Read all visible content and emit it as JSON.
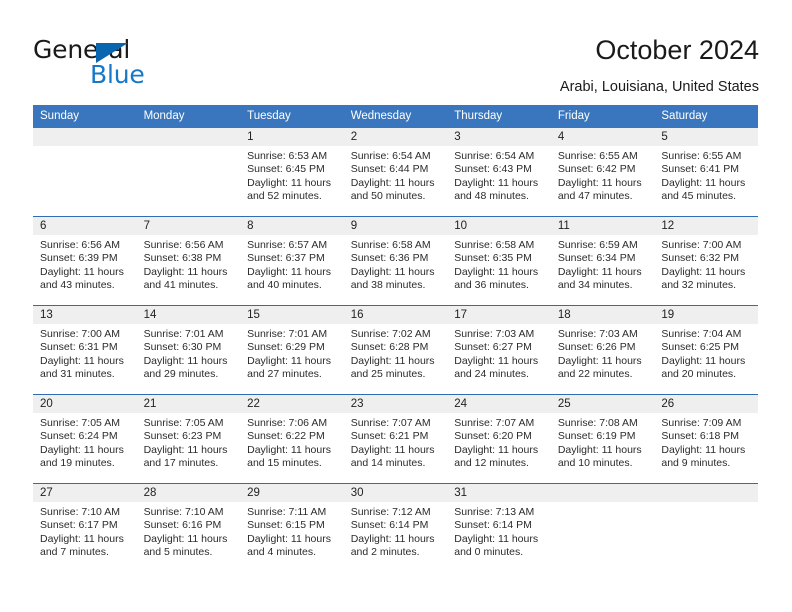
{
  "brand": {
    "name_top": "General",
    "name_bottom": "Blue",
    "triangle_color": "#0a65b0",
    "blue_text_color": "#1878c8"
  },
  "header": {
    "title": "October 2024",
    "subtitle": "Arabi, Louisiana, United States"
  },
  "theme": {
    "header_blue": "#3a76bd",
    "row_divider_blue": "#2f6cb3",
    "daynum_band_gray": "#efefef"
  },
  "calendar": {
    "weekday_headers": [
      "Sunday",
      "Monday",
      "Tuesday",
      "Wednesday",
      "Thursday",
      "Friday",
      "Saturday"
    ],
    "weeks": [
      [
        {
          "day": "",
          "sunrise": "",
          "sunset": "",
          "daylight_line1": "",
          "daylight_line2": ""
        },
        {
          "day": "",
          "sunrise": "",
          "sunset": "",
          "daylight_line1": "",
          "daylight_line2": ""
        },
        {
          "day": "1",
          "sunrise": "Sunrise: 6:53 AM",
          "sunset": "Sunset: 6:45 PM",
          "daylight_line1": "Daylight: 11 hours",
          "daylight_line2": "and 52 minutes."
        },
        {
          "day": "2",
          "sunrise": "Sunrise: 6:54 AM",
          "sunset": "Sunset: 6:44 PM",
          "daylight_line1": "Daylight: 11 hours",
          "daylight_line2": "and 50 minutes."
        },
        {
          "day": "3",
          "sunrise": "Sunrise: 6:54 AM",
          "sunset": "Sunset: 6:43 PM",
          "daylight_line1": "Daylight: 11 hours",
          "daylight_line2": "and 48 minutes."
        },
        {
          "day": "4",
          "sunrise": "Sunrise: 6:55 AM",
          "sunset": "Sunset: 6:42 PM",
          "daylight_line1": "Daylight: 11 hours",
          "daylight_line2": "and 47 minutes."
        },
        {
          "day": "5",
          "sunrise": "Sunrise: 6:55 AM",
          "sunset": "Sunset: 6:41 PM",
          "daylight_line1": "Daylight: 11 hours",
          "daylight_line2": "and 45 minutes."
        }
      ],
      [
        {
          "day": "6",
          "sunrise": "Sunrise: 6:56 AM",
          "sunset": "Sunset: 6:39 PM",
          "daylight_line1": "Daylight: 11 hours",
          "daylight_line2": "and 43 minutes."
        },
        {
          "day": "7",
          "sunrise": "Sunrise: 6:56 AM",
          "sunset": "Sunset: 6:38 PM",
          "daylight_line1": "Daylight: 11 hours",
          "daylight_line2": "and 41 minutes."
        },
        {
          "day": "8",
          "sunrise": "Sunrise: 6:57 AM",
          "sunset": "Sunset: 6:37 PM",
          "daylight_line1": "Daylight: 11 hours",
          "daylight_line2": "and 40 minutes."
        },
        {
          "day": "9",
          "sunrise": "Sunrise: 6:58 AM",
          "sunset": "Sunset: 6:36 PM",
          "daylight_line1": "Daylight: 11 hours",
          "daylight_line2": "and 38 minutes."
        },
        {
          "day": "10",
          "sunrise": "Sunrise: 6:58 AM",
          "sunset": "Sunset: 6:35 PM",
          "daylight_line1": "Daylight: 11 hours",
          "daylight_line2": "and 36 minutes."
        },
        {
          "day": "11",
          "sunrise": "Sunrise: 6:59 AM",
          "sunset": "Sunset: 6:34 PM",
          "daylight_line1": "Daylight: 11 hours",
          "daylight_line2": "and 34 minutes."
        },
        {
          "day": "12",
          "sunrise": "Sunrise: 7:00 AM",
          "sunset": "Sunset: 6:32 PM",
          "daylight_line1": "Daylight: 11 hours",
          "daylight_line2": "and 32 minutes."
        }
      ],
      [
        {
          "day": "13",
          "sunrise": "Sunrise: 7:00 AM",
          "sunset": "Sunset: 6:31 PM",
          "daylight_line1": "Daylight: 11 hours",
          "daylight_line2": "and 31 minutes."
        },
        {
          "day": "14",
          "sunrise": "Sunrise: 7:01 AM",
          "sunset": "Sunset: 6:30 PM",
          "daylight_line1": "Daylight: 11 hours",
          "daylight_line2": "and 29 minutes."
        },
        {
          "day": "15",
          "sunrise": "Sunrise: 7:01 AM",
          "sunset": "Sunset: 6:29 PM",
          "daylight_line1": "Daylight: 11 hours",
          "daylight_line2": "and 27 minutes."
        },
        {
          "day": "16",
          "sunrise": "Sunrise: 7:02 AM",
          "sunset": "Sunset: 6:28 PM",
          "daylight_line1": "Daylight: 11 hours",
          "daylight_line2": "and 25 minutes."
        },
        {
          "day": "17",
          "sunrise": "Sunrise: 7:03 AM",
          "sunset": "Sunset: 6:27 PM",
          "daylight_line1": "Daylight: 11 hours",
          "daylight_line2": "and 24 minutes."
        },
        {
          "day": "18",
          "sunrise": "Sunrise: 7:03 AM",
          "sunset": "Sunset: 6:26 PM",
          "daylight_line1": "Daylight: 11 hours",
          "daylight_line2": "and 22 minutes."
        },
        {
          "day": "19",
          "sunrise": "Sunrise: 7:04 AM",
          "sunset": "Sunset: 6:25 PM",
          "daylight_line1": "Daylight: 11 hours",
          "daylight_line2": "and 20 minutes."
        }
      ],
      [
        {
          "day": "20",
          "sunrise": "Sunrise: 7:05 AM",
          "sunset": "Sunset: 6:24 PM",
          "daylight_line1": "Daylight: 11 hours",
          "daylight_line2": "and 19 minutes."
        },
        {
          "day": "21",
          "sunrise": "Sunrise: 7:05 AM",
          "sunset": "Sunset: 6:23 PM",
          "daylight_line1": "Daylight: 11 hours",
          "daylight_line2": "and 17 minutes."
        },
        {
          "day": "22",
          "sunrise": "Sunrise: 7:06 AM",
          "sunset": "Sunset: 6:22 PM",
          "daylight_line1": "Daylight: 11 hours",
          "daylight_line2": "and 15 minutes."
        },
        {
          "day": "23",
          "sunrise": "Sunrise: 7:07 AM",
          "sunset": "Sunset: 6:21 PM",
          "daylight_line1": "Daylight: 11 hours",
          "daylight_line2": "and 14 minutes."
        },
        {
          "day": "24",
          "sunrise": "Sunrise: 7:07 AM",
          "sunset": "Sunset: 6:20 PM",
          "daylight_line1": "Daylight: 11 hours",
          "daylight_line2": "and 12 minutes."
        },
        {
          "day": "25",
          "sunrise": "Sunrise: 7:08 AM",
          "sunset": "Sunset: 6:19 PM",
          "daylight_line1": "Daylight: 11 hours",
          "daylight_line2": "and 10 minutes."
        },
        {
          "day": "26",
          "sunrise": "Sunrise: 7:09 AM",
          "sunset": "Sunset: 6:18 PM",
          "daylight_line1": "Daylight: 11 hours",
          "daylight_line2": "and 9 minutes."
        }
      ],
      [
        {
          "day": "27",
          "sunrise": "Sunrise: 7:10 AM",
          "sunset": "Sunset: 6:17 PM",
          "daylight_line1": "Daylight: 11 hours",
          "daylight_line2": "and 7 minutes."
        },
        {
          "day": "28",
          "sunrise": "Sunrise: 7:10 AM",
          "sunset": "Sunset: 6:16 PM",
          "daylight_line1": "Daylight: 11 hours",
          "daylight_line2": "and 5 minutes."
        },
        {
          "day": "29",
          "sunrise": "Sunrise: 7:11 AM",
          "sunset": "Sunset: 6:15 PM",
          "daylight_line1": "Daylight: 11 hours",
          "daylight_line2": "and 4 minutes."
        },
        {
          "day": "30",
          "sunrise": "Sunrise: 7:12 AM",
          "sunset": "Sunset: 6:14 PM",
          "daylight_line1": "Daylight: 11 hours",
          "daylight_line2": "and 2 minutes."
        },
        {
          "day": "31",
          "sunrise": "Sunrise: 7:13 AM",
          "sunset": "Sunset: 6:14 PM",
          "daylight_line1": "Daylight: 11 hours",
          "daylight_line2": "and 0 minutes."
        },
        {
          "day": "",
          "sunrise": "",
          "sunset": "",
          "daylight_line1": "",
          "daylight_line2": ""
        },
        {
          "day": "",
          "sunrise": "",
          "sunset": "",
          "daylight_line1": "",
          "daylight_line2": ""
        }
      ]
    ]
  }
}
